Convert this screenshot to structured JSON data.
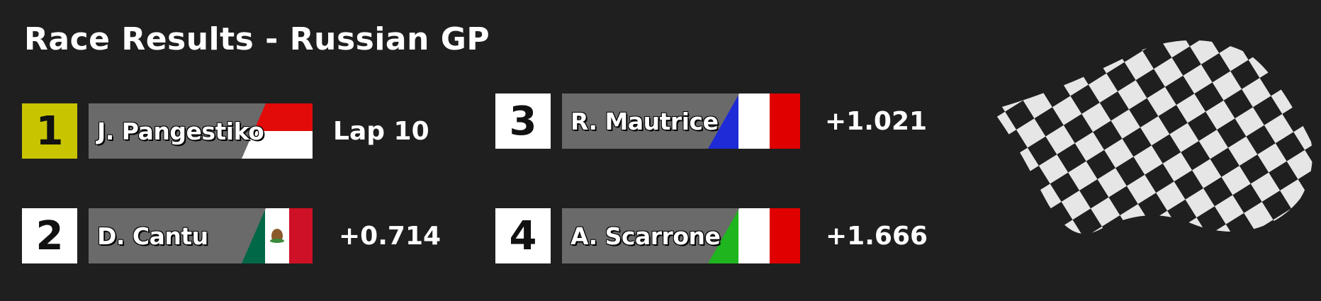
{
  "title": "Race Results - Russian GP",
  "results": [
    {
      "position": "1",
      "driver": "J. Pangestiko",
      "gap": "Lap 10",
      "flag": "indonesia-flag-icon"
    },
    {
      "position": "2",
      "driver": "D. Cantu",
      "gap": "+0.714",
      "flag": "mexico-flag-icon"
    },
    {
      "position": "3",
      "driver": "R. Mautrice",
      "gap": "+1.021",
      "flag": "france-flag-icon"
    },
    {
      "position": "4",
      "driver": "A. Scarrone",
      "gap": "+1.666",
      "flag": "italy-flag-icon"
    }
  ],
  "decoration": "checkered-flag-icon",
  "colors": {
    "background": "#1f1f1f",
    "leader_badge": "#c8c400",
    "name_plate": "#6a6a6a"
  }
}
